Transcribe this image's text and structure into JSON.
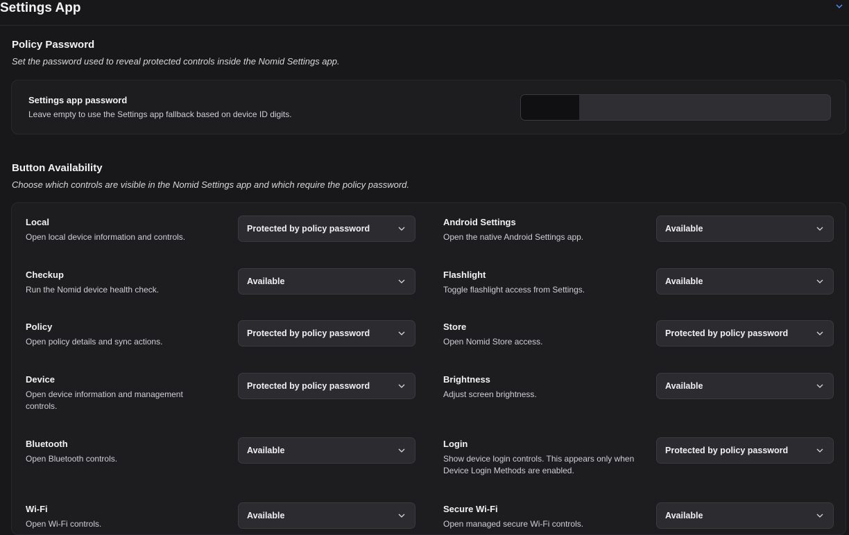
{
  "header": {
    "title": "Settings App",
    "collapse_icon": "chevron-down-icon",
    "accent": "#4f8ff7"
  },
  "policy_password": {
    "title": "Policy Password",
    "description": "Set the password used to reveal protected controls inside the Nomid Settings app.",
    "field_label": "Settings app password",
    "field_help": "Leave empty to use the Settings app fallback based on device ID digits."
  },
  "button_availability": {
    "title": "Button Availability",
    "description": "Choose which controls are visible in the Nomid Settings app and which require the policy password.",
    "left": [
      {
        "label": "Local",
        "desc": "Open local device information and controls.",
        "value": "Protected by policy password"
      },
      {
        "label": "Checkup",
        "desc": "Run the Nomid device health check.",
        "value": "Available"
      },
      {
        "label": "Policy",
        "desc": "Open policy details and sync actions.",
        "value": "Protected by policy password"
      },
      {
        "label": "Device",
        "desc": "Open device information and management controls.",
        "value": "Protected by policy password"
      },
      {
        "label": "Bluetooth",
        "desc": "Open Bluetooth controls.",
        "value": "Available"
      },
      {
        "label": "Wi-Fi",
        "desc": "Open Wi-Fi controls.",
        "value": "Available"
      }
    ],
    "right": [
      {
        "label": "Android Settings",
        "desc": "Open the native Android Settings app.",
        "value": "Available"
      },
      {
        "label": "Flashlight",
        "desc": "Toggle flashlight access from Settings.",
        "value": "Available"
      },
      {
        "label": "Store",
        "desc": "Open Nomid Store access.",
        "value": "Protected by policy password"
      },
      {
        "label": "Brightness",
        "desc": "Adjust screen brightness.",
        "value": "Available"
      },
      {
        "label": "Login",
        "desc": "Show device login controls. This appears only when Device Login Methods are enabled.",
        "value": "Protected by policy password"
      },
      {
        "label": "Secure Wi-Fi",
        "desc": "Open managed secure Wi-Fi controls.",
        "value": "Available"
      }
    ]
  }
}
